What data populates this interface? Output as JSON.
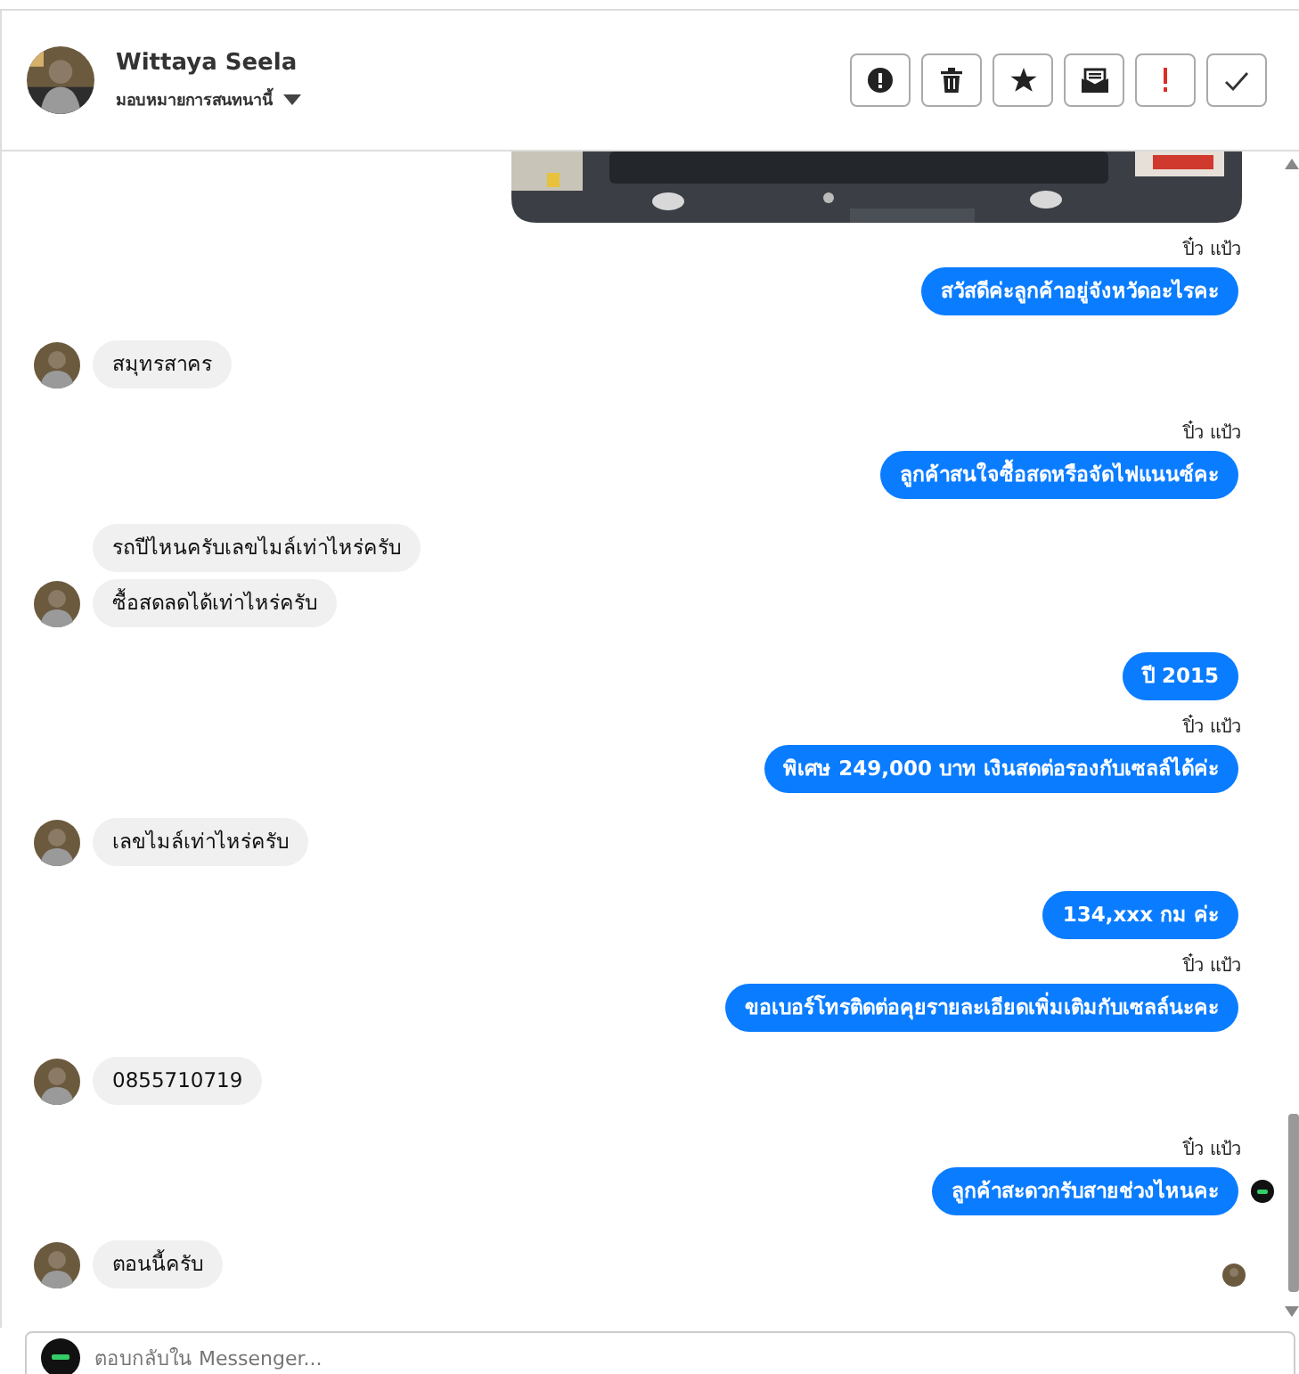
{
  "header": {
    "name": "Wittaya Seela",
    "assign_label": "มอบหมายการสนทนานี้",
    "actions": [
      {
        "kind": "alert"
      },
      {
        "kind": "trash"
      },
      {
        "kind": "star"
      },
      {
        "kind": "envelope"
      },
      {
        "kind": "important"
      },
      {
        "kind": "check"
      }
    ]
  },
  "messages": [
    {
      "kind": "picture"
    },
    {
      "kind": "sent",
      "sender": "ปิ๋ว แป้ว",
      "text": "สวัสดีค่ะลูกค้าอยู่จังหวัดอะไรคะ"
    },
    {
      "kind": "received",
      "avatar": true,
      "text": "สมุทรสาคร"
    },
    {
      "kind": "sent",
      "sender": "ปิ๋ว แป้ว",
      "text": "ลูกค้าสนใจซื้อสดหรือจัดไฟแนนซ์คะ"
    },
    {
      "kind": "received",
      "avatar": false,
      "text": "รถปีไหนครับเลขไมล์เท่าไหร่ครับ"
    },
    {
      "kind": "received",
      "avatar": true,
      "text": "ซื้อสดลดได้เท่าไหร่ครับ"
    },
    {
      "kind": "sent",
      "text": "ปี  2015"
    },
    {
      "kind": "sent",
      "sender": "ปิ๋ว แป้ว",
      "text": "พิเศษ 249,000 บาท   เงินสดต่อรองกับเซลล์ได้ค่ะ"
    },
    {
      "kind": "received",
      "avatar": true,
      "text": "เลขไมล์เท่าไหร่ครับ"
    },
    {
      "kind": "sent",
      "text": "134,xxx  กม  ค่ะ"
    },
    {
      "kind": "sent",
      "sender": "ปิ๋ว แป้ว",
      "text": "ขอเบอร์โทรติดต่อคุยรายละเอียดเพิ่มเติมกับเซลล์นะคะ"
    },
    {
      "kind": "received",
      "avatar": true,
      "text": "0855710719"
    },
    {
      "kind": "sent",
      "sender": "ปิ๋ว แป้ว",
      "text": "ลูกค้าสะดวกรับสายช่วงไหนคะ",
      "receipt": true
    },
    {
      "kind": "received",
      "avatar": true,
      "text": "ตอนนี้ครับ",
      "receipt": true
    }
  ],
  "composer": {
    "placeholder": "ตอบกลับใน Messenger..."
  }
}
